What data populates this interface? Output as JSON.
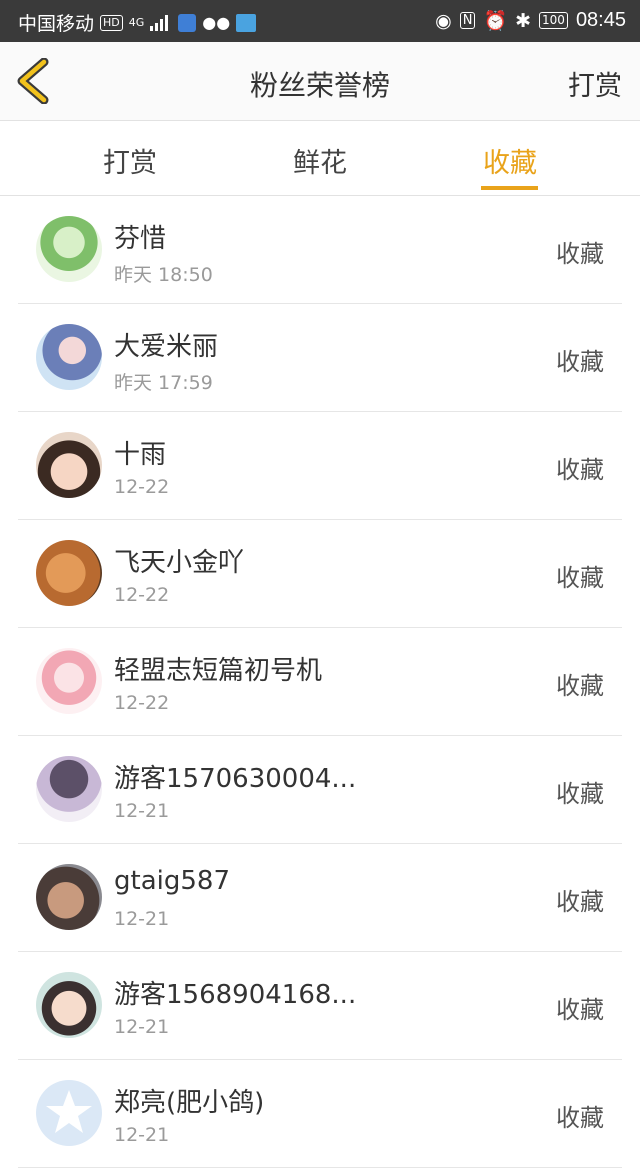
{
  "status_bar": {
    "carrier": "中国移动",
    "hd": "HD",
    "network": "4G",
    "battery": "100",
    "time": "08:45"
  },
  "header": {
    "title": "粉丝荣誉榜",
    "action": "打赏"
  },
  "tabs": [
    {
      "label": "打赏",
      "active": false
    },
    {
      "label": "鲜花",
      "active": false
    },
    {
      "label": "收藏",
      "active": true
    }
  ],
  "accent_color": "#e9a31a",
  "list": [
    {
      "name": "芬惜",
      "time": "昨天 18:50",
      "action": "收藏"
    },
    {
      "name": "大爱米丽",
      "time": "昨天 17:59",
      "action": "收藏"
    },
    {
      "name": "十雨",
      "time": "12-22",
      "action": "收藏"
    },
    {
      "name": "飞天小金吖",
      "time": "12-22",
      "action": "收藏"
    },
    {
      "name": "轻盟志短篇初号机",
      "time": "12-22",
      "action": "收藏"
    },
    {
      "name": "游客1570630004...",
      "time": "12-21",
      "action": "收藏"
    },
    {
      "name": "gtaig587",
      "time": "12-21",
      "action": "收藏"
    },
    {
      "name": "游客1568904168...",
      "time": "12-21",
      "action": "收藏"
    },
    {
      "name": "郑亮(肥小鸽)",
      "time": "12-21",
      "action": "收藏"
    }
  ]
}
